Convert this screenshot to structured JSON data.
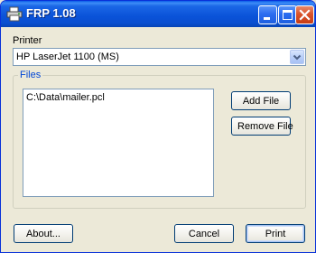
{
  "window": {
    "title": "FRP 1.08"
  },
  "printer": {
    "label": "Printer",
    "selected": "HP LaserJet 1100 (MS)"
  },
  "files": {
    "group_label": "Files",
    "items": [
      "C:\\Data\\mailer.pcl"
    ],
    "add_label": "Add File",
    "remove_label": "Remove File"
  },
  "footer": {
    "about_label": "About...",
    "cancel_label": "Cancel",
    "print_label": "Print"
  },
  "colors": {
    "titlebar": "#0a52d8",
    "window_bg": "#ece9d8",
    "group_label": "#0046d5",
    "close_button": "#d9532b"
  },
  "icons": {
    "app": "printer-icon",
    "minimize": "minimize-icon",
    "maximize": "maximize-icon",
    "close": "close-icon",
    "dropdown": "chevron-down-icon"
  }
}
